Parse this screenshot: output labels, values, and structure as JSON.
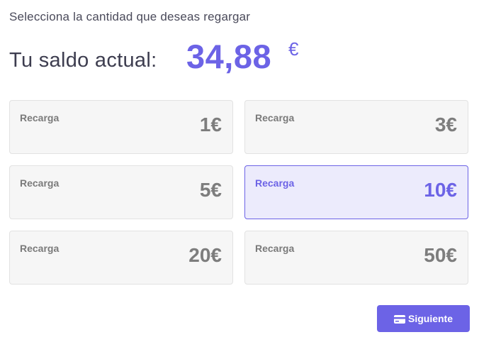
{
  "instruction": "Selecciona la cantidad que deseas regargar",
  "balance": {
    "label": "Tu saldo actual:",
    "value": "34,88",
    "currency": "€"
  },
  "options": [
    {
      "label": "Recarga",
      "amount": "1€",
      "selected": false
    },
    {
      "label": "Recarga",
      "amount": "3€",
      "selected": false
    },
    {
      "label": "Recarga",
      "amount": "5€",
      "selected": false
    },
    {
      "label": "Recarga",
      "amount": "10€",
      "selected": true
    },
    {
      "label": "Recarga",
      "amount": "20€",
      "selected": false
    },
    {
      "label": "Recarga",
      "amount": "50€",
      "selected": false
    }
  ],
  "next_button": {
    "label": "Siguiente",
    "icon": "credit-card-icon"
  },
  "colors": {
    "accent": "#6c63e6",
    "selected_bg": "#ecebfc",
    "card_bg": "#f6f6f6"
  }
}
